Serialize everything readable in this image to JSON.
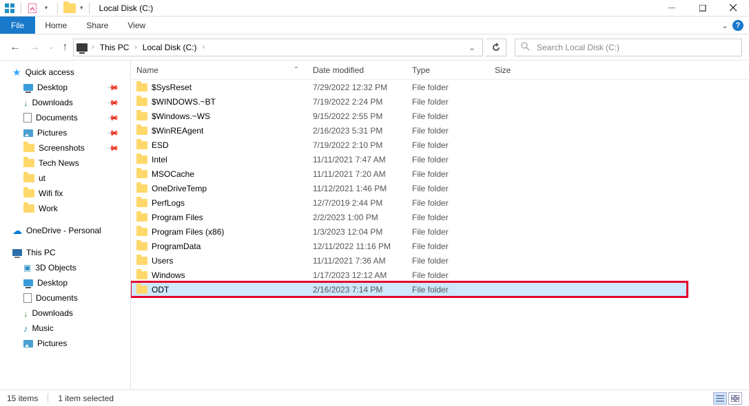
{
  "titlebar": {
    "title": "Local Disk (C:)",
    "qat_sep": "|"
  },
  "ribbon": {
    "file": "File",
    "tabs": [
      "Home",
      "Share",
      "View"
    ]
  },
  "nav": {
    "breadcrumb": [
      "This PC",
      "Local Disk (C:)"
    ],
    "search_placeholder": "Search Local Disk (C:)"
  },
  "sidebar": {
    "quick_access": "Quick access",
    "qa_items": [
      {
        "label": "Desktop",
        "pinned": true,
        "icon": "desktop"
      },
      {
        "label": "Downloads",
        "pinned": true,
        "icon": "download"
      },
      {
        "label": "Documents",
        "pinned": true,
        "icon": "document"
      },
      {
        "label": "Pictures",
        "pinned": true,
        "icon": "image"
      },
      {
        "label": "Screenshots",
        "pinned": true,
        "icon": "folder"
      },
      {
        "label": "Tech News",
        "pinned": false,
        "icon": "folder"
      },
      {
        "label": "ut",
        "pinned": false,
        "icon": "folder"
      },
      {
        "label": "Wifi fix",
        "pinned": false,
        "icon": "folder"
      },
      {
        "label": "Work",
        "pinned": false,
        "icon": "folder"
      }
    ],
    "onedrive": "OneDrive - Personal",
    "this_pc": "This PC",
    "pc_items": [
      {
        "label": "3D Objects",
        "icon": "obj3d"
      },
      {
        "label": "Desktop",
        "icon": "desktop"
      },
      {
        "label": "Documents",
        "icon": "document"
      },
      {
        "label": "Downloads",
        "icon": "download"
      },
      {
        "label": "Music",
        "icon": "music"
      },
      {
        "label": "Pictures",
        "icon": "image"
      }
    ]
  },
  "columns": {
    "name": "Name",
    "date": "Date modified",
    "type": "Type",
    "size": "Size"
  },
  "rows": [
    {
      "name": "$SysReset",
      "date": "7/29/2022 12:32 PM",
      "type": "File folder"
    },
    {
      "name": "$WINDOWS.~BT",
      "date": "7/19/2022 2:24 PM",
      "type": "File folder"
    },
    {
      "name": "$Windows.~WS",
      "date": "9/15/2022 2:55 PM",
      "type": "File folder"
    },
    {
      "name": "$WinREAgent",
      "date": "2/16/2023 5:31 PM",
      "type": "File folder"
    },
    {
      "name": "ESD",
      "date": "7/19/2022 2:10 PM",
      "type": "File folder"
    },
    {
      "name": "Intel",
      "date": "11/11/2021 7:47 AM",
      "type": "File folder"
    },
    {
      "name": "MSOCache",
      "date": "11/11/2021 7:20 AM",
      "type": "File folder"
    },
    {
      "name": "OneDriveTemp",
      "date": "11/12/2021 1:46 PM",
      "type": "File folder"
    },
    {
      "name": "PerfLogs",
      "date": "12/7/2019 2:44 PM",
      "type": "File folder"
    },
    {
      "name": "Program Files",
      "date": "2/2/2023 1:00 PM",
      "type": "File folder"
    },
    {
      "name": "Program Files (x86)",
      "date": "1/3/2023 12:04 PM",
      "type": "File folder"
    },
    {
      "name": "ProgramData",
      "date": "12/11/2022 11:16 PM",
      "type": "File folder"
    },
    {
      "name": "Users",
      "date": "11/11/2021 7:36 AM",
      "type": "File folder"
    },
    {
      "name": "Windows",
      "date": "1/17/2023 12:12 AM",
      "type": "File folder"
    },
    {
      "name": "ODT",
      "date": "2/16/2023 7:14 PM",
      "type": "File folder",
      "selected": true
    }
  ],
  "status": {
    "items": "15 items",
    "selected": "1 item selected"
  }
}
